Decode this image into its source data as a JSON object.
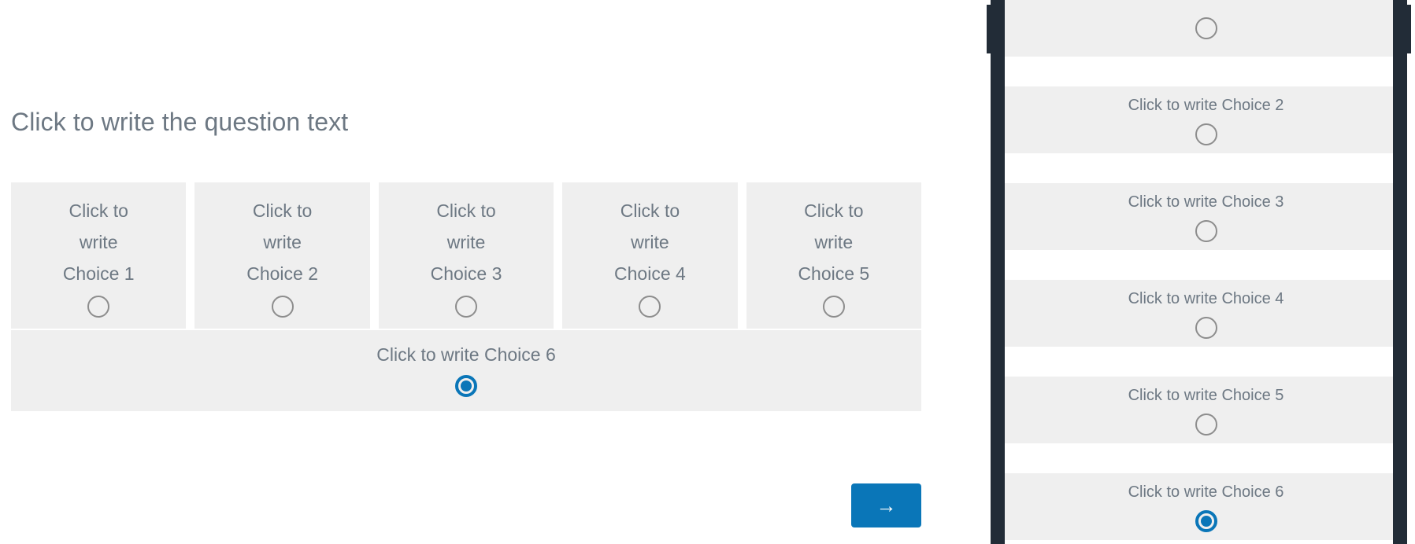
{
  "colors": {
    "accent_blue": "#0a76b8",
    "card_gray": "#efefef",
    "text_gray": "#6d7883",
    "radio_gray": "#8d8d8d",
    "bezel_dark": "#222c37",
    "page_white": "#ffffff"
  },
  "editor": {
    "question_text": "Click to write the question text",
    "choices": [
      {
        "label": "Click to write Choice 1",
        "selected": false
      },
      {
        "label": "Click to write Choice 2",
        "selected": false
      },
      {
        "label": "Click to write Choice 3",
        "selected": false
      },
      {
        "label": "Click to write Choice 4",
        "selected": false
      },
      {
        "label": "Click to write Choice 5",
        "selected": false
      }
    ],
    "wide_choice": {
      "label": "Click to write Choice 6",
      "selected": true
    },
    "next_button": {
      "label": "→",
      "icon": "arrow-right-icon"
    }
  },
  "preview": {
    "items": [
      {
        "label": "",
        "selected": false,
        "clipped": true
      },
      {
        "label": "Click to write Choice 2",
        "selected": false
      },
      {
        "label": "Click to write Choice 3",
        "selected": false
      },
      {
        "label": "Click to write Choice 4",
        "selected": false
      },
      {
        "label": "Click to write Choice 5",
        "selected": false
      },
      {
        "label": "Click to write Choice 6",
        "selected": true
      }
    ]
  }
}
